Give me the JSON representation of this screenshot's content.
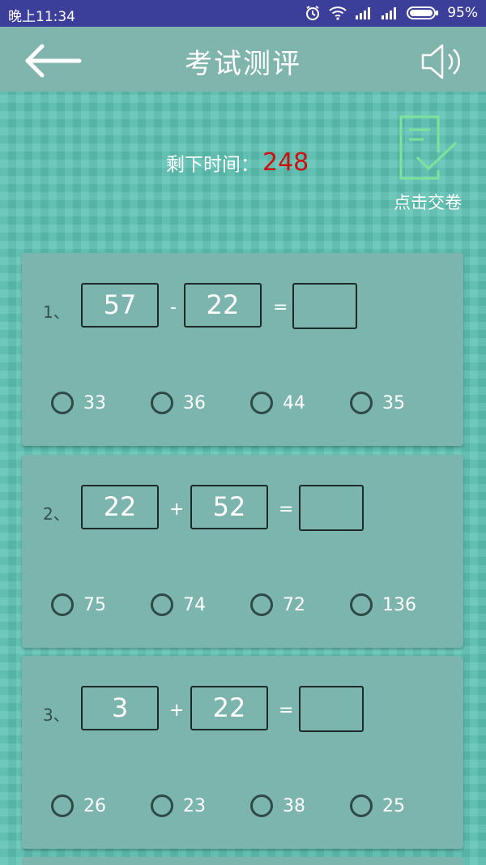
{
  "status_bar": {
    "time": "晚上11:34",
    "battery": "95%"
  },
  "app_bar": {
    "title": "考试测评"
  },
  "timer": {
    "label": "剩下时间：",
    "value": "248"
  },
  "submit": {
    "label": "点击交卷"
  },
  "questions": [
    {
      "number": "1、",
      "a": "57",
      "op": "-",
      "b": "22",
      "eq": "=",
      "options": [
        "33",
        "36",
        "44",
        "35"
      ]
    },
    {
      "number": "2、",
      "a": "22",
      "op": "+",
      "b": "52",
      "eq": "=",
      "options": [
        "75",
        "74",
        "72",
        "136"
      ]
    },
    {
      "number": "3、",
      "a": "3",
      "op": "+",
      "b": "22",
      "eq": "=",
      "options": [
        "26",
        "23",
        "38",
        "25"
      ]
    }
  ],
  "icons": {
    "back": "arrow-left-icon",
    "sound": "speaker-icon",
    "submit": "checklist-icon",
    "status": [
      "alarm-icon",
      "wifi-icon",
      "signal-icon",
      "battery-icon"
    ]
  },
  "colors": {
    "status_bar": "#3c3f99",
    "app_bar": "#7fb5ad",
    "background": "#5cc1b2",
    "card": "#7cb5ae",
    "timer_value": "#cc1111",
    "submit_icon": "#7de39a"
  }
}
